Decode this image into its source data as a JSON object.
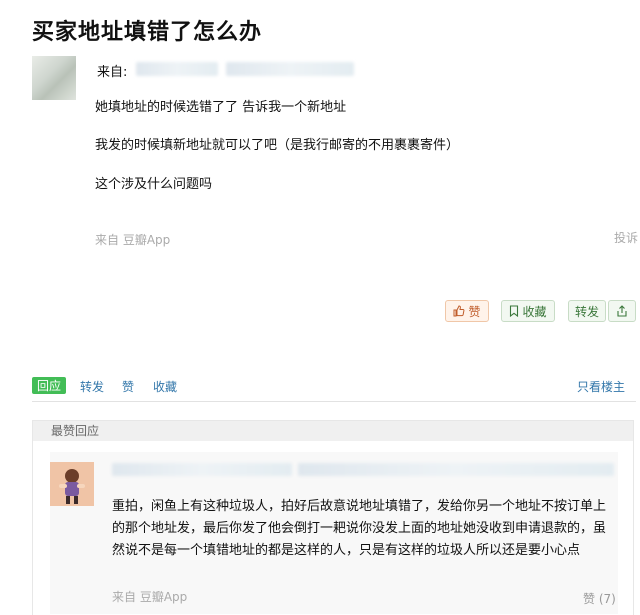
{
  "title": "买家地址填错了怎么办",
  "post": {
    "from_label": "来自:",
    "paragraphs": [
      "她填地址的时候选错了了 告诉我一个新地址",
      "我发的时候填新地址就可以了吧（是我行邮寄的不用裹裹寄件）",
      "这个涉及什么问题吗"
    ],
    "source": "来自 豆瓣App",
    "report": "投诉"
  },
  "actions": {
    "like": "赞",
    "collect": "收藏",
    "share": "转发"
  },
  "action_bar": {
    "reply": "回应",
    "share": "转发",
    "like": "赞",
    "collect": "收藏",
    "only_op": "只看楼主"
  },
  "top_replies": {
    "header": "最赞回应",
    "reply": {
      "text": "重拍，闲鱼上有这种垃圾人，拍好后故意说地址填错了，发给你另一个地址不按订单上的那个地址发，最后你发了他会倒打一耙说你没发上面的地址她没收到申请退款的，虽然说不是每一个填错地址的都是这样的人，只是有这样的垃圾人所以还是要小心点",
      "source": "来自 豆瓣App",
      "likes": "赞 (7)"
    }
  },
  "colors": {
    "reply_green": "#42bd56",
    "link_blue": "#3377aa",
    "like_orange": "#c05c2a"
  }
}
